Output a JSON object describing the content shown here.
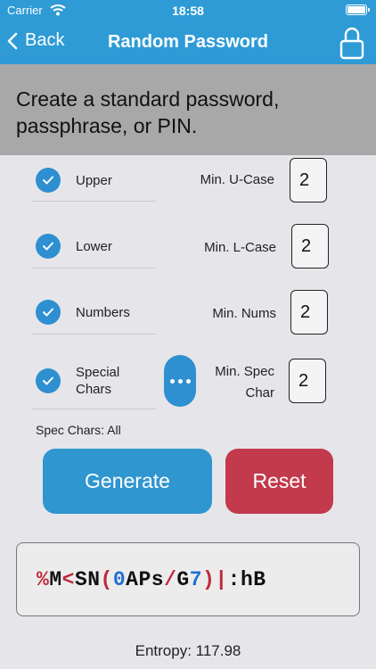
{
  "status_bar": {
    "carrier": "Carrier",
    "time": "18:58"
  },
  "nav": {
    "back_label": "Back",
    "title": "Random Password"
  },
  "banner": {
    "text": "Create a standard password, passphrase, or PIN."
  },
  "options": [
    {
      "label": "Upper",
      "checked": true,
      "min_label": "Min. U-Case",
      "min_value": "2"
    },
    {
      "label": "Lower",
      "checked": true,
      "min_label": "Min. L-Case",
      "min_value": "2"
    },
    {
      "label": "Numbers",
      "checked": true,
      "min_label": "Min. Nums",
      "min_value": "2"
    },
    {
      "label": "Special Chars",
      "checked": true,
      "min_label": "Min. Spec Char",
      "min_value": "2"
    }
  ],
  "spec_chars_text": "Spec Chars: All",
  "buttons": {
    "generate": "Generate",
    "reset": "Reset"
  },
  "password": {
    "segments": [
      {
        "text": "%",
        "kind": "symbol"
      },
      {
        "text": "M",
        "kind": "letter"
      },
      {
        "text": "<",
        "kind": "symbol"
      },
      {
        "text": "SN",
        "kind": "letter"
      },
      {
        "text": "(",
        "kind": "symbol"
      },
      {
        "text": "0",
        "kind": "digit"
      },
      {
        "text": "APs",
        "kind": "letter"
      },
      {
        "text": "/",
        "kind": "symbol"
      },
      {
        "text": "G",
        "kind": "letter"
      },
      {
        "text": "7",
        "kind": "digit"
      },
      {
        "text": ")|",
        "kind": "symbol"
      },
      {
        "text": ":",
        "kind": "letter"
      },
      {
        "text": "hB",
        "kind": "letter"
      }
    ]
  },
  "entropy_text": "Entropy: 117.98",
  "colors": {
    "header": "#2e9bd6",
    "banner": "#a8a8a8",
    "checkbox": "#2e8fd1",
    "generate": "#2f96cf",
    "reset": "#c23a4c",
    "symbol_char": "#c0283c",
    "digit_char": "#1f6fd1",
    "letter_char": "#111111"
  }
}
